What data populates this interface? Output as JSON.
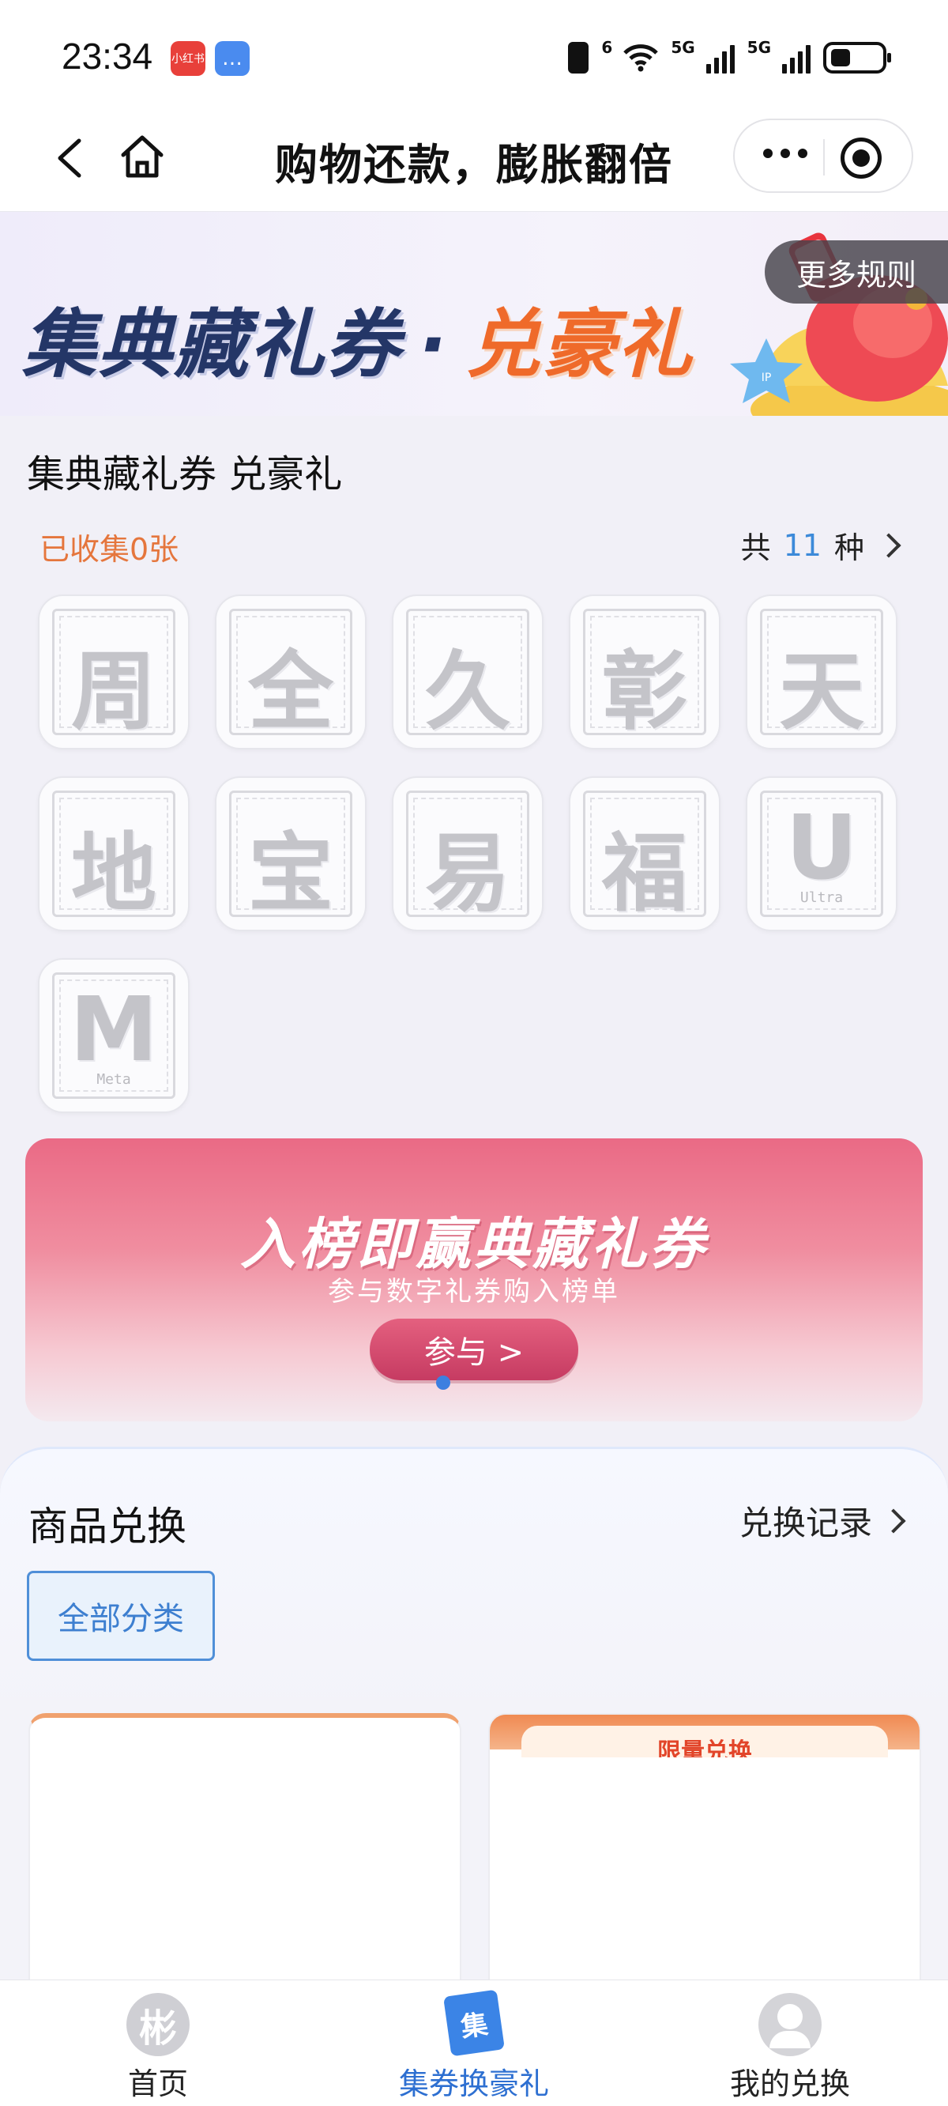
{
  "status_bar": {
    "time": "23:34",
    "app_badge_1": "小红书",
    "net_1": "6",
    "net_2": "5G",
    "net_3": "5G"
  },
  "nav": {
    "title": "购物还款，膨胀翻倍",
    "back_icon": "chevron-left-icon",
    "home_icon": "home-icon",
    "more_icon": "more-dots-icon",
    "close_icon": "target-icon"
  },
  "banner": {
    "title_part1": "集典藏礼券",
    "separator": "·",
    "title_part2": "兑豪礼",
    "more_rules": "更多规则"
  },
  "collection": {
    "title": "集典藏礼券 兑豪礼",
    "collected_label": "已收集0张",
    "total_prefix": "共",
    "total_count": "11",
    "total_suffix": "种",
    "cards": [
      {
        "glyph": "周",
        "sub": ""
      },
      {
        "glyph": "全",
        "sub": ""
      },
      {
        "glyph": "久",
        "sub": ""
      },
      {
        "glyph": "彰",
        "sub": ""
      },
      {
        "glyph": "天",
        "sub": ""
      },
      {
        "glyph": "地",
        "sub": ""
      },
      {
        "glyph": "宝",
        "sub": ""
      },
      {
        "glyph": "易",
        "sub": ""
      },
      {
        "glyph": "福",
        "sub": ""
      },
      {
        "glyph": "U",
        "sub": "Ultra"
      },
      {
        "glyph": "M",
        "sub": "Meta"
      }
    ]
  },
  "promo": {
    "title": "入榜即赢典藏礼券",
    "subtitle": "参与数字礼券购入榜单",
    "button": "参与 >"
  },
  "exchange": {
    "title": "商品兑换",
    "record": "兑换记录",
    "category": "全部分类",
    "right_card_ribbon": "限量兑换"
  },
  "tabs": [
    {
      "label": "首页",
      "icon": "home-icon",
      "glyph": "彬"
    },
    {
      "label": "集券换豪礼",
      "icon": "coupon-icon",
      "glyph": "集"
    },
    {
      "label": "我的兑换",
      "icon": "user-icon",
      "glyph": ""
    }
  ],
  "colors": {
    "accent_blue": "#3d7fd0",
    "orange": "#e5763d",
    "promo_pink": "#ea6a85"
  }
}
